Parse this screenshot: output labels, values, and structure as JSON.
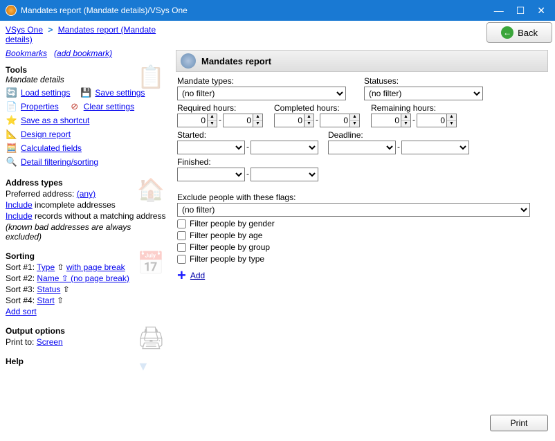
{
  "window": {
    "title": "Mandates report (Mandate details)/VSys One"
  },
  "breadcrumb": {
    "root": "VSys One",
    "current": "Mandates report (Mandate details)"
  },
  "bookmarks": {
    "label": "Bookmarks",
    "add": "(add bookmark)"
  },
  "tools": {
    "heading": "Tools",
    "sub": "Mandate details",
    "load": "Load settings",
    "save": "Save settings",
    "properties": "Properties",
    "clear": "Clear settings",
    "shortcut": "Save as a shortcut",
    "design": "Design report",
    "calc": "Calculated fields",
    "filter": "Detail filtering/sorting"
  },
  "addr": {
    "heading": "Address types",
    "pref_label": "Preferred address:",
    "pref_value": "(any)",
    "include": "Include",
    "incomplete": " incomplete addresses",
    "nomatch": " records without a matching address",
    "note": "(known bad addresses are always excluded)"
  },
  "sorting": {
    "heading": "Sorting",
    "s1": "Sort #1: ",
    "s1a": "Type",
    "s1b": " ⇧  ",
    "s1c": "with page break",
    "s2": "Sort #2: ",
    "s2a": "Name",
    "s2b": "  ⇧ (no page break)",
    "s3": "Sort #3: ",
    "s3a": "Status",
    "s3b": " ⇧",
    "s4": "Sort #4: ",
    "s4a": "Start",
    "s4b": " ⇧",
    "add": "Add sort"
  },
  "output": {
    "heading": "Output options",
    "printto": "Print to: ",
    "printto_val": "Screen"
  },
  "help": {
    "heading": "Help"
  },
  "back": "Back",
  "panel": {
    "title": "Mandates report"
  },
  "form": {
    "mandate_types": "Mandate types:",
    "statuses": "Statuses:",
    "nofilter": "(no filter)",
    "required": "Required hours:",
    "completed": "Completed hours:",
    "remaining": "Remaining hours:",
    "started": "Started:",
    "deadline": "Deadline:",
    "finished": "Finished:",
    "zero": "0",
    "exclude": "Exclude people with these flags:",
    "f_gender": "Filter people by gender",
    "f_age": "Filter people by age",
    "f_group": "Filter people by group",
    "f_type": "Filter people by type",
    "add": "Add"
  },
  "print": "Print"
}
